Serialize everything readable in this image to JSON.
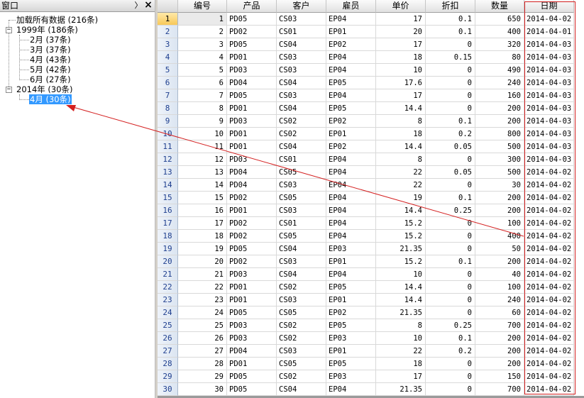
{
  "panel": {
    "title": "窗口",
    "pin_icon": "pin-icon",
    "close_icon": "close-icon"
  },
  "tree": {
    "root": {
      "label": "加载所有数据 (216条)"
    },
    "year1999": {
      "label": "1999年 (186条)",
      "expanded": true,
      "months": [
        {
          "label": "2月 (37条)"
        },
        {
          "label": "3月 (37条)"
        },
        {
          "label": "4月 (43条)"
        },
        {
          "label": "5月 (42条)"
        },
        {
          "label": "6月 (27条)"
        }
      ]
    },
    "year2014": {
      "label": "2014年 (30条)",
      "expanded": true,
      "months": [
        {
          "label": "4月 (30条)",
          "selected": true
        }
      ]
    },
    "toggle_expanded_symbol": "−"
  },
  "grid": {
    "columns": [
      "编号",
      "产品",
      "客户",
      "雇员",
      "单价",
      "折扣",
      "数量",
      "日期"
    ],
    "current_row": 1,
    "rows": [
      [
        "1",
        "1",
        "PD05",
        "CS03",
        "EP04",
        "17",
        "0.1",
        "650",
        "2014-04-02"
      ],
      [
        "2",
        "2",
        "PD02",
        "CS01",
        "EP01",
        "20",
        "0.1",
        "400",
        "2014-04-01"
      ],
      [
        "3",
        "3",
        "PD05",
        "CS04",
        "EP02",
        "17",
        "0",
        "320",
        "2014-04-03"
      ],
      [
        "4",
        "4",
        "PD01",
        "CS03",
        "EP04",
        "18",
        "0.15",
        "80",
        "2014-04-03"
      ],
      [
        "5",
        "5",
        "PD03",
        "CS03",
        "EP04",
        "10",
        "0",
        "490",
        "2014-04-03"
      ],
      [
        "6",
        "6",
        "PD04",
        "CS04",
        "EP05",
        "17.6",
        "0",
        "240",
        "2014-04-03"
      ],
      [
        "7",
        "7",
        "PD05",
        "CS03",
        "EP04",
        "17",
        "0",
        "160",
        "2014-04-03"
      ],
      [
        "8",
        "8",
        "PD01",
        "CS04",
        "EP05",
        "14.4",
        "0",
        "200",
        "2014-04-03"
      ],
      [
        "9",
        "9",
        "PD03",
        "CS02",
        "EP02",
        "8",
        "0.1",
        "200",
        "2014-04-03"
      ],
      [
        "10",
        "10",
        "PD01",
        "CS02",
        "EP01",
        "18",
        "0.2",
        "800",
        "2014-04-03"
      ],
      [
        "11",
        "11",
        "PD01",
        "CS04",
        "EP02",
        "14.4",
        "0.05",
        "500",
        "2014-04-03"
      ],
      [
        "12",
        "12",
        "PD03",
        "CS01",
        "EP04",
        "8",
        "0",
        "300",
        "2014-04-03"
      ],
      [
        "13",
        "13",
        "PD04",
        "CS05",
        "EP04",
        "22",
        "0.05",
        "500",
        "2014-04-02"
      ],
      [
        "14",
        "14",
        "PD04",
        "CS03",
        "EP04",
        "22",
        "0",
        "30",
        "2014-04-02"
      ],
      [
        "15",
        "15",
        "PD02",
        "CS05",
        "EP04",
        "19",
        "0.1",
        "200",
        "2014-04-02"
      ],
      [
        "16",
        "16",
        "PD01",
        "CS03",
        "EP04",
        "14.4",
        "0.25",
        "200",
        "2014-04-02"
      ],
      [
        "17",
        "17",
        "PD02",
        "CS01",
        "EP04",
        "15.2",
        "0",
        "100",
        "2014-04-02"
      ],
      [
        "18",
        "18",
        "PD02",
        "CS05",
        "EP04",
        "15.2",
        "0",
        "400",
        "2014-04-02"
      ],
      [
        "19",
        "19",
        "PD05",
        "CS04",
        "EP03",
        "21.35",
        "0",
        "50",
        "2014-04-02"
      ],
      [
        "20",
        "20",
        "PD02",
        "CS03",
        "EP01",
        "15.2",
        "0.1",
        "200",
        "2014-04-02"
      ],
      [
        "21",
        "21",
        "PD03",
        "CS04",
        "EP04",
        "10",
        "0",
        "40",
        "2014-04-02"
      ],
      [
        "22",
        "22",
        "PD01",
        "CS02",
        "EP05",
        "14.4",
        "0",
        "100",
        "2014-04-02"
      ],
      [
        "23",
        "23",
        "PD01",
        "CS03",
        "EP01",
        "14.4",
        "0",
        "240",
        "2014-04-02"
      ],
      [
        "24",
        "24",
        "PD05",
        "CS05",
        "EP02",
        "21.35",
        "0",
        "60",
        "2014-04-02"
      ],
      [
        "25",
        "25",
        "PD03",
        "CS02",
        "EP05",
        "8",
        "0.25",
        "700",
        "2014-04-02"
      ],
      [
        "26",
        "26",
        "PD03",
        "CS02",
        "EP03",
        "10",
        "0.1",
        "200",
        "2014-04-02"
      ],
      [
        "27",
        "27",
        "PD04",
        "CS03",
        "EP01",
        "22",
        "0.2",
        "200",
        "2014-04-02"
      ],
      [
        "28",
        "28",
        "PD01",
        "CS05",
        "EP05",
        "18",
        "0",
        "200",
        "2014-04-02"
      ],
      [
        "29",
        "29",
        "PD05",
        "CS02",
        "EP03",
        "17",
        "0",
        "150",
        "2014-04-02"
      ],
      [
        "30",
        "30",
        "PD05",
        "CS04",
        "EP04",
        "21.35",
        "0",
        "700",
        "2014-04-02"
      ]
    ]
  },
  "colors": {
    "annotation_red": "#d42020",
    "selection_blue": "#3399ff",
    "current_row_header": "#f7c85a"
  }
}
